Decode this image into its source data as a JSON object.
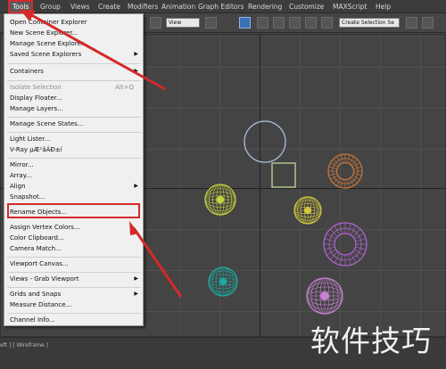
{
  "menubar": {
    "items": [
      "Tools",
      "Group",
      "Views",
      "Create",
      "Modifiers",
      "Animation",
      "Graph Editors",
      "Rendering",
      "Customize",
      "MAXScript",
      "Help"
    ],
    "active": "Tools"
  },
  "toolbar": {
    "view_select": "View",
    "selection_set_placeholder": "Create Selection Se"
  },
  "tools_menu": {
    "items": [
      {
        "label": "Open Container Explorer"
      },
      {
        "label": "New Scene Explorer..."
      },
      {
        "label": "Manage Scene Explorer..."
      },
      {
        "label": "Saved Scene Explorers",
        "submenu": true
      },
      {
        "label": "Containers",
        "submenu": true
      },
      {
        "label": "Isolate Selection",
        "shortcut": "Alt+Q",
        "disabled": true
      },
      {
        "label": "Display Floater..."
      },
      {
        "label": "Manage Layers..."
      },
      {
        "label": "Manage Scene States..."
      },
      {
        "label": "Light Lister..."
      },
      {
        "label": "V-Ray µÆ¹âÁÐ±í"
      },
      {
        "label": "Mirror..."
      },
      {
        "label": "Array..."
      },
      {
        "label": "Align",
        "submenu": true
      },
      {
        "label": "Snapshot..."
      },
      {
        "label": "Rename Objects..."
      },
      {
        "label": "Assign Vertex Colors..."
      },
      {
        "label": "Color Clipboard..."
      },
      {
        "label": "Camera Match..."
      },
      {
        "label": "Viewport Canvas..."
      },
      {
        "label": "Views - Grab Viewport",
        "submenu": true
      },
      {
        "label": "Grids and Snaps",
        "submenu": true
      },
      {
        "label": "Measure Distance..."
      },
      {
        "label": "Channel Info..."
      }
    ],
    "highlighted": "Rename Objects..."
  },
  "viewport": {
    "label": "eft ] [ Wireframe ]"
  },
  "objects": [
    {
      "name": "circle-outline",
      "color": "#aec8e6"
    },
    {
      "name": "box-outline",
      "color": "#c8e6a0"
    },
    {
      "name": "sphere-orange",
      "color": "#c8783c"
    },
    {
      "name": "sphere-yellow",
      "color": "#c8d23c"
    },
    {
      "name": "sphere-gold",
      "color": "#d2c83c"
    },
    {
      "name": "torus-purple",
      "color": "#b464d2"
    },
    {
      "name": "sphere-teal",
      "color": "#1eaaa0"
    },
    {
      "name": "sphere-pink",
      "color": "#c882d2"
    }
  ],
  "watermark": "软件技巧",
  "colors": {
    "annotation": "#d42a2a"
  }
}
